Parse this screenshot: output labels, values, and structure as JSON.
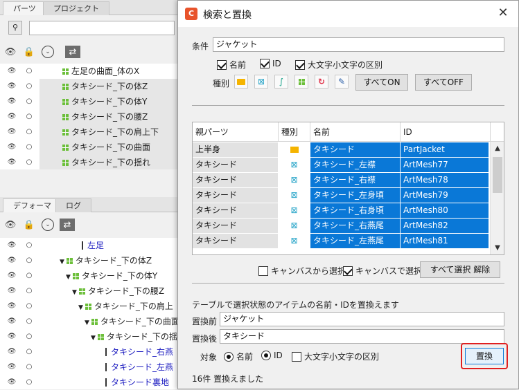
{
  "parts_panel": {
    "tabs": [
      "パーツ",
      "プロジェクト"
    ],
    "rows": [
      {
        "label": "左足の曲面_体のX",
        "highlight": false
      },
      {
        "label": "タキシード_下の体Z",
        "highlight": true
      },
      {
        "label": "タキシード_下の体Y",
        "highlight": true
      },
      {
        "label": "タキシード_下の腰Z",
        "highlight": true
      },
      {
        "label": "タキシード_下の肩上下",
        "highlight": true
      },
      {
        "label": "タキシード_下の曲面",
        "highlight": true
      },
      {
        "label": "タキシード_下の揺れ",
        "highlight": true
      }
    ]
  },
  "deformer_panel": {
    "tabs": [
      "デフォーマ",
      "ログ"
    ],
    "rows": [
      {
        "label": "左足",
        "indent": 118,
        "kind": "mesh"
      },
      {
        "label": "タキシード_下の体Z",
        "indent": 86,
        "kind": "warp"
      },
      {
        "label": "タキシード_下の体Y",
        "indent": 95,
        "kind": "warp"
      },
      {
        "label": "タキシード_下の腰Z",
        "indent": 104,
        "kind": "warp"
      },
      {
        "label": "タキシード_下の肩上",
        "indent": 113,
        "kind": "warp"
      },
      {
        "label": "タキシード_下の曲面",
        "indent": 122,
        "kind": "warp"
      },
      {
        "label": "タキシード_下の揺",
        "indent": 131,
        "kind": "warp"
      },
      {
        "label": "タキシード_右燕",
        "indent": 152,
        "kind": "mesh"
      },
      {
        "label": "タキシード_左燕",
        "indent": 152,
        "kind": "mesh"
      },
      {
        "label": "タキシード裏地",
        "indent": 152,
        "kind": "mesh"
      }
    ]
  },
  "dialog": {
    "title": "検索と置換",
    "close_icon": "close-icon",
    "condition_label": "条件",
    "condition_value": "ジャケット",
    "check_name": "名前",
    "check_id": "ID",
    "check_case": "大文字小文字の区別",
    "kind_label": "種別",
    "kind_icons": [
      "folder-icon",
      "mesh-icon",
      "path-icon",
      "warp-deformer-icon",
      "rotation-deformer-icon",
      "glue-icon"
    ],
    "all_on": "すべてON",
    "all_off": "すべてOFF",
    "table": {
      "headers": [
        "親パーツ",
        "種別",
        "名前",
        "ID"
      ],
      "rows": [
        {
          "parent": "上半身",
          "kind": "folder",
          "name": "タキシード",
          "id": "PartJacket"
        },
        {
          "parent": "タキシード",
          "kind": "mesh",
          "name": "タキシード_左襟",
          "id": "ArtMesh77"
        },
        {
          "parent": "タキシード",
          "kind": "mesh",
          "name": "タキシード_右襟",
          "id": "ArtMesh78"
        },
        {
          "parent": "タキシード",
          "kind": "mesh",
          "name": "タキシード_左身頃",
          "id": "ArtMesh79"
        },
        {
          "parent": "タキシード",
          "kind": "mesh",
          "name": "タキシード_右身頃",
          "id": "ArtMesh80"
        },
        {
          "parent": "タキシード",
          "kind": "mesh",
          "name": "タキシード_右燕尾",
          "id": "ArtMesh82"
        },
        {
          "parent": "タキシード",
          "kind": "mesh",
          "name": "タキシード_左燕尾",
          "id": "ArtMesh81"
        }
      ]
    },
    "select_from_canvas": "キャンバスから選択",
    "select_on_canvas": "キャンバスで選択",
    "deselect_all": "すべて選択 解除",
    "replace_desc": "テーブルで選択状態のアイテムの名前・IDを置換えます",
    "before_label": "置換前",
    "before_value": "ジャケット",
    "after_label": "置換後",
    "after_value": "タキシード",
    "target_label": "対象",
    "radio_name": "名前",
    "radio_id": "ID",
    "target_case": "大文字小文字の区別",
    "replace_button": "置換",
    "status": "16件 置換えました"
  }
}
